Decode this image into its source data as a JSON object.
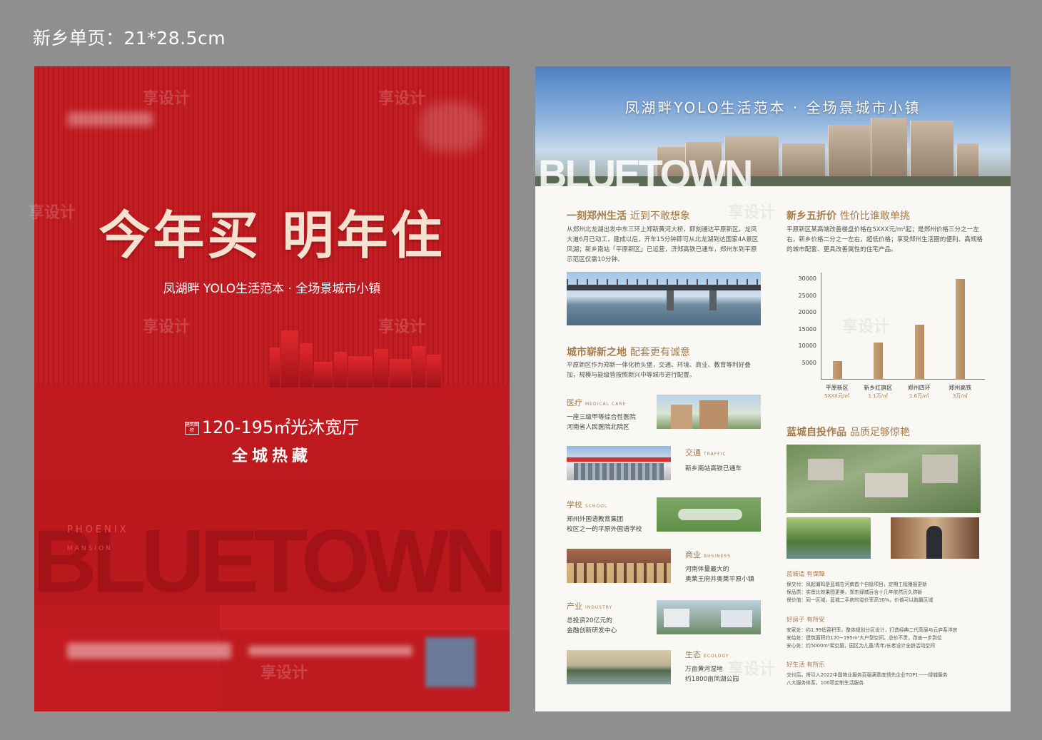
{
  "spec": "新乡单页：21*28.5cm",
  "front": {
    "headline": "今年买 明年住",
    "subtitle": "凤湖畔 YOLO生活范本 · 全场景城市小镇",
    "area_badge": "建筑面积",
    "area": "120-195㎡光沐宽厅",
    "hot": "全城热藏",
    "phoenix": "PHOENIX",
    "mansion": "MANSION",
    "bigword": "BLUETOWN"
  },
  "back": {
    "hero_title": "凤湖畔YOLO生活范本 · 全场景城市小镇",
    "hero_word": "BLUETOWN",
    "sec1": {
      "title": "一刻郑州生活",
      "sub": "近到不敢想象",
      "body": "从郑州北龙湖出发中东三环上郑新黄河大桥，即刻通达平原新区。龙凤大道6月已动工，建成以后，开车15分钟即可从北龙湖到达国家4A景区凤湖；新乡南站「平原新区」已运营，济郑高铁已通车，郑州东到平原示范区仅需10分钟。"
    },
    "sec2": {
      "title": "新乡五折价",
      "sub": "性价比谁敢单挑",
      "body": "平原新区某高端改善楼盘价格在5XXX元/m²起；是郑州价格三分之一左右，新乡价格二分之一左右，超低价格；享受郑州生活圈的便利、高规格的城市配套、更具改善属性的住宅产品。"
    },
    "sec3": {
      "title": "城市崭新之地",
      "sub": "配套更有诚意",
      "body": "平原新区作为郑新一体化桥头堡，交通、环境、商业、教育等利好叠加，规模与能级皆按照新兴中等城市进行配置。"
    },
    "categories": [
      {
        "title": "医疗",
        "en": "MEDICAL CARE",
        "lines": [
          "一座三级甲等综合性医院",
          "河南省人民医院北院区"
        ]
      },
      {
        "title": "交通",
        "en": "TRAFFIC",
        "lines": [
          "新乡南站高铁已通车"
        ]
      },
      {
        "title": "学校",
        "en": "SCHOOL",
        "lines": [
          "郑州外国语教育集团",
          "校区之一的平原外国语学校"
        ]
      },
      {
        "title": "商业",
        "en": "BUSINESS",
        "lines": [
          "河南体量最大的",
          "奥莱王府井奥莱平原小镇"
        ]
      },
      {
        "title": "产业",
        "en": "INDUSTRY",
        "lines": [
          "总投资20亿元的",
          "金融创新研发中心"
        ]
      },
      {
        "title": "生态",
        "en": "ECOLOGY",
        "lines": [
          "万亩黄河湿地",
          "约1800亩凤湖公园"
        ]
      }
    ],
    "sec4": {
      "title": "蓝城自投作品",
      "sub": "品质足够惊艳"
    },
    "bullets": [
      {
        "head": "蓝城造 有保障",
        "items": [
          "保交付：凤起潮鸣是蓝城在河南首个自投项目，定期工程播报更新",
          "保品质：实景比效果图更美，郑东绿城百合十几年依然历久弥新",
          "保价值：同一区域，蓝城二手房的溢价率高30%，价值可以跑赢区域"
        ]
      },
      {
        "head": "好房子 有所安",
        "items": [
          "安家处：约1.99低容积率，整体规划分区设计，打造经典二代高层与云庐系洋房",
          "安给处：建筑面积约120~195m²大户型空间，总价不贵，改善一步到位",
          "安心处：约5000m²架空层，园区为儿童/青年/长者设计全龄活动空间"
        ]
      },
      {
        "head": "好生活 有所乐",
        "items": [
          "交付后，将引入2022中国物业服务百强满意度领先企业TOP1——绿城服务",
          "八大服务体系，100项定制生活服务"
        ]
      }
    ]
  },
  "chart_data": {
    "type": "bar",
    "categories": [
      "平原新区",
      "新乡红旗区",
      "郑州四环",
      "郑州高铁"
    ],
    "values": [
      5500,
      11000,
      16500,
      30000
    ],
    "price_labels": [
      "5XXX元/㎡",
      "1.1万/㎡",
      "1.6万/㎡",
      "3万/㎡"
    ],
    "yticks": [
      5000,
      10000,
      15000,
      20000,
      25000,
      30000
    ],
    "ylim": [
      0,
      32000
    ],
    "title": "",
    "xlabel": "",
    "ylabel": ""
  },
  "watermark": "享设计",
  "colors": {
    "front_red": "#c21d23",
    "gold": "#a57c4c",
    "headline": "#f6e0cf"
  }
}
